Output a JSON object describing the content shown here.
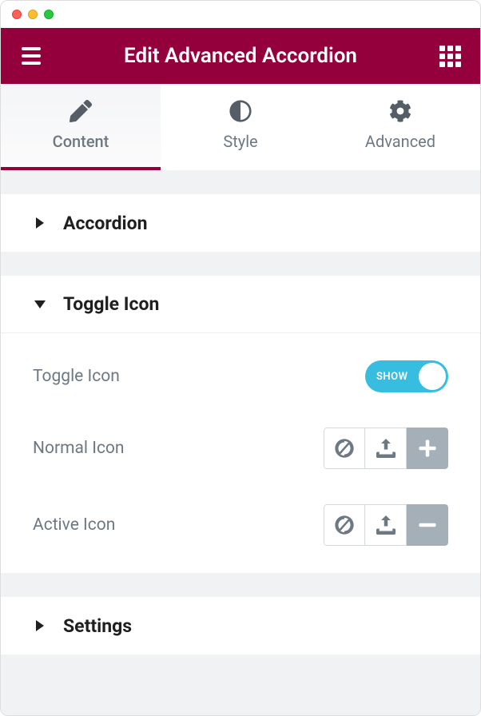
{
  "header": {
    "title": "Edit Advanced Accordion"
  },
  "tabs": {
    "content": "Content",
    "style": "Style",
    "advanced": "Advanced"
  },
  "sections": {
    "accordion": {
      "title": "Accordion"
    },
    "toggle_icon": {
      "title": "Toggle Icon",
      "toggle_label": "Toggle Icon",
      "toggle_value": "SHOW",
      "normal_label": "Normal Icon",
      "active_label": "Active Icon"
    },
    "settings": {
      "title": "Settings"
    }
  }
}
